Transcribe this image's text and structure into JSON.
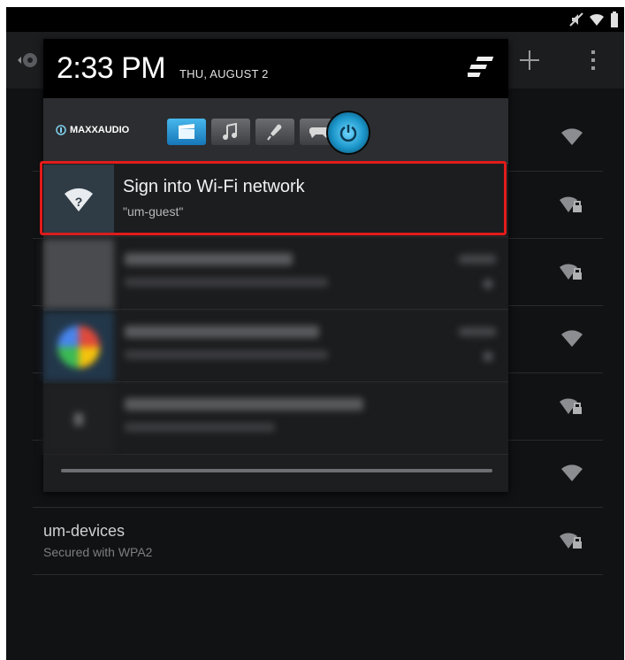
{
  "status_bar": {
    "icons": [
      "mute-icon",
      "wifi-icon",
      "battery-icon"
    ]
  },
  "settings": {
    "action_bar": {
      "icons": [
        "settings-icon",
        "add-icon",
        "overflow-menu-icon"
      ]
    },
    "networks": [
      {
        "name": "",
        "secured": false
      },
      {
        "name": "",
        "secured": true
      },
      {
        "name": "",
        "secured": true
      },
      {
        "name": "",
        "secured": false
      },
      {
        "name": "",
        "secured": true
      },
      {
        "name": "",
        "secured": false
      },
      {
        "name": "um-devices",
        "subtitle": "Secured with WPA2",
        "secured": true
      }
    ]
  },
  "shade": {
    "time": "2:33 PM",
    "date": "THU, AUGUST 2",
    "maxx": {
      "brand": "MAXXAUDIO",
      "presets": [
        "movie-icon",
        "music-icon",
        "voice-icon",
        "game-icon"
      ],
      "active_preset": "movie-icon",
      "power_on": true
    },
    "notifications": [
      {
        "title": "Sign into Wi-Fi network",
        "subtitle": "\"um-guest\"",
        "highlighted": true,
        "icon": "wifi-question-icon",
        "highlight_color": "#e21b1b"
      }
    ]
  },
  "colors": {
    "accent_blue": "#33b5e5",
    "highlight_red": "#e21b1b",
    "background": "#111214"
  }
}
